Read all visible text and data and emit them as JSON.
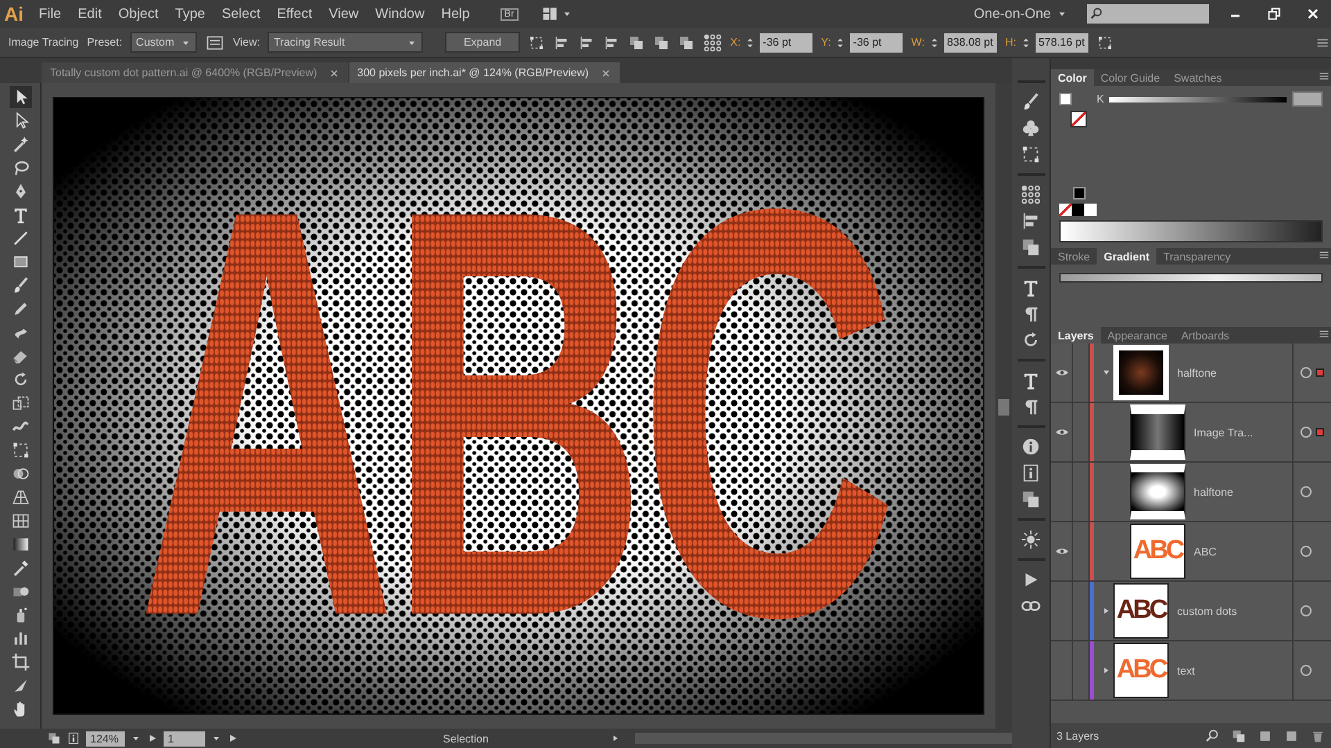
{
  "app": {
    "logo": "Ai",
    "bridge": "Br",
    "workspace": "One-on-One"
  },
  "menu": [
    "File",
    "Edit",
    "Object",
    "Type",
    "Select",
    "Effect",
    "View",
    "Window",
    "Help"
  ],
  "control_bar": {
    "label": "Image Tracing",
    "preset_label": "Preset:",
    "preset": "Custom",
    "view_label": "View:",
    "view": "Tracing Result",
    "expand": "Expand",
    "fields": [
      {
        "label": "X:",
        "value": "-36 pt"
      },
      {
        "label": "Y:",
        "value": "-36 pt"
      },
      {
        "label": "W:",
        "value": "838.08 pt"
      },
      {
        "label": "H:",
        "value": "578.16 pt"
      }
    ]
  },
  "tabs": [
    {
      "label": "Totally custom dot pattern.ai @ 6400% (RGB/Preview)",
      "selected": false
    },
    {
      "label": "300 pixels per inch.ai* @ 124% (RGB/Preview)",
      "selected": true
    }
  ],
  "artwork": {
    "text": "ABC"
  },
  "color_panel": {
    "tabs": [
      {
        "label": "Color",
        "selected": true
      },
      {
        "label": "Color Guide",
        "selected": false
      },
      {
        "label": "Swatches",
        "selected": false
      }
    ],
    "channel": "K"
  },
  "stroke_panel": {
    "tabs": [
      {
        "label": "Stroke",
        "selected": false
      },
      {
        "label": "Gradient",
        "selected": true
      },
      {
        "label": "Transparency",
        "selected": false
      }
    ]
  },
  "layers_panel": {
    "tabs": [
      {
        "label": "Layers",
        "selected": true
      },
      {
        "label": "Appearance",
        "selected": false
      },
      {
        "label": "Artboards",
        "selected": false
      }
    ],
    "layers": [
      {
        "name": "halftone",
        "visible": true,
        "expanded": true,
        "color": "#c9504f",
        "kind": "dark",
        "selected": true,
        "children": [
          {
            "name": "Image Tra...",
            "visible": true,
            "kind": "trace",
            "selected": true
          },
          {
            "name": "halftone",
            "visible": false,
            "kind": "dots",
            "selected": false
          },
          {
            "name": "ABC",
            "visible": true,
            "kind": "abc",
            "thumb_text": "ABC",
            "selected": false
          }
        ]
      },
      {
        "name": "custom dots",
        "visible": false,
        "expanded": false,
        "color": "#4a6fd1",
        "kind": "abc-dark",
        "thumb_text": "ABC",
        "selected": false
      },
      {
        "name": "text",
        "visible": false,
        "expanded": false,
        "color": "#9a4fd1",
        "kind": "abc",
        "thumb_text": "ABC",
        "selected": false
      }
    ],
    "footer": "3 Layers"
  },
  "status": {
    "zoom": "124%",
    "artboard": "1",
    "tool": "Selection"
  }
}
